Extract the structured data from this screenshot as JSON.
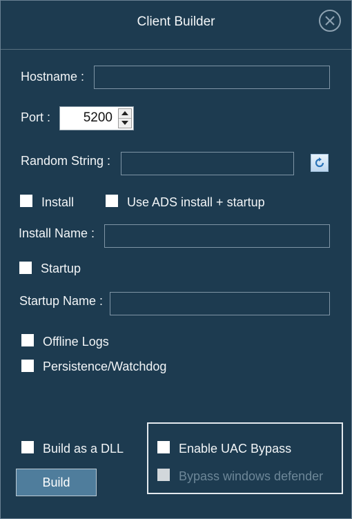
{
  "window": {
    "title": "Client Builder"
  },
  "hostname": {
    "label": "Hostname :",
    "value": ""
  },
  "port": {
    "label": "Port :",
    "value": "5200"
  },
  "random_string": {
    "label": "Random String :",
    "value": ""
  },
  "install": {
    "label": "Install",
    "checked": false
  },
  "ads_install": {
    "label": "Use ADS install + startup",
    "checked": false
  },
  "install_name": {
    "label": "Install Name :",
    "value": ""
  },
  "startup": {
    "label": "Startup",
    "checked": false
  },
  "startup_name": {
    "label": "Startup Name :",
    "value": ""
  },
  "offline_logs": {
    "label": "Offline Logs",
    "checked": false
  },
  "persistence": {
    "label": "Persistence/Watchdog",
    "checked": false
  },
  "build_dll": {
    "label": "Build as a DLL",
    "checked": false
  },
  "uac_bypass": {
    "label": "Enable UAC Bypass",
    "checked": false
  },
  "bypass_defender": {
    "label": "Bypass windows defender",
    "checked": false,
    "enabled": false
  },
  "build_button": {
    "label": "Build"
  },
  "colors": {
    "window_bg": "#1d3b50",
    "border": "#6b8294",
    "button_bg": "#4f7d9c",
    "disabled_text": "#6d8798"
  },
  "icons": {
    "close": "close-circle-icon",
    "refresh": "refresh-icon"
  }
}
